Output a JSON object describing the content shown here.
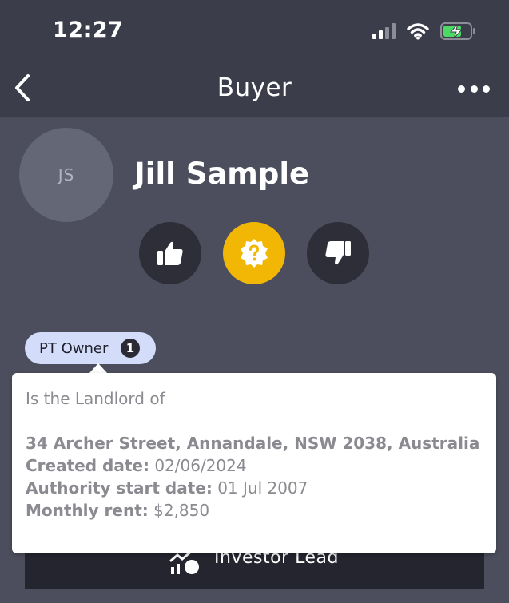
{
  "status_bar": {
    "time": "12:27",
    "signal_bars_active": 2,
    "battery_color": "#4cd964"
  },
  "nav": {
    "title": "Buyer",
    "back_icon": "chevron-left-icon",
    "more_icon": "more-dots-icon"
  },
  "contact": {
    "initials": "JS",
    "name": "Jill Sample"
  },
  "rating": {
    "options": [
      {
        "name": "thumbs-up",
        "icon": "thumbs-up-icon",
        "active": false
      },
      {
        "name": "unsure",
        "icon": "question-badge-icon",
        "active": true
      },
      {
        "name": "thumbs-down",
        "icon": "thumbs-down-icon",
        "active": false
      }
    ],
    "active_color": "#f2b705"
  },
  "tag": {
    "label": "PT Owner",
    "count": "1"
  },
  "tooltip": {
    "intro": "Is the Landlord of",
    "address": "34 Archer Street, Annandale, NSW 2038, Australia",
    "created_label": "Created date:",
    "created_value": "02/06/2024",
    "authority_label": "Authority start date:",
    "authority_value": "01 Jul 2007",
    "rent_label": "Monthly rent:",
    "rent_value": "$2,850"
  },
  "bottom_action": {
    "label": "Investor Lead",
    "icon": "investor-chart-icon"
  }
}
